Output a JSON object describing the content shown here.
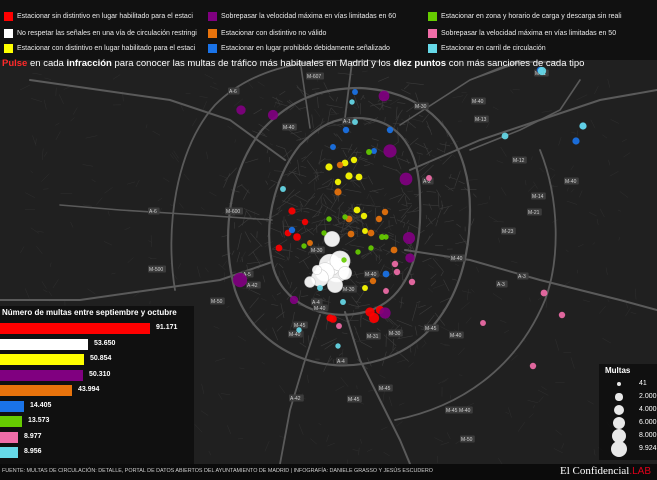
{
  "legend_items": [
    {
      "label": "Estacionar sin distintivo en lugar habilitado para el estaci",
      "color": "#ff0000"
    },
    {
      "label": "Sobrepasar la velocidad máxima en vías limitadas en 60",
      "color": "#800080"
    },
    {
      "label": "Estacionar en zona y horario de carga y descarga sin reali",
      "color": "#66cc00"
    },
    {
      "label": "No respetar las señales en una vía de circulación restringi",
      "color": "#ffffff"
    },
    {
      "label": "Estacionar con distintivo no válido",
      "color": "#e8730c"
    },
    {
      "label": "Sobrepasar la velocidad máxima en vías limitadas en 50",
      "color": "#f06da8"
    },
    {
      "label": "Estacionar con distintivo en lugar habilitado para el estaci",
      "color": "#ffff00"
    },
    {
      "label": "Estacionar en lugar prohibido debidamente señalizado",
      "color": "#1a73e8"
    },
    {
      "label": "Estacionar en carril de circulación",
      "color": "#66d9e8"
    }
  ],
  "headline": {
    "pulse": "Pulse",
    "part1": " en cada ",
    "infraccion": "infracción",
    "part2": " para conocer las multas de tráfico más habituales en Madrid y los ",
    "diez_puntos": "diez puntos",
    "part3": " con más sanciones de cada tipo"
  },
  "bar_chart": {
    "title": "Número de multas entre septiembre y octubre",
    "bars": [
      {
        "value": 91171,
        "label": "91.171",
        "color": "#ff0000"
      },
      {
        "value": 53650,
        "label": "53.650",
        "color": "#ffffff"
      },
      {
        "value": 50854,
        "label": "50.854",
        "color": "#ffff00"
      },
      {
        "value": 50310,
        "label": "50.310",
        "color": "#800080"
      },
      {
        "value": 43994,
        "label": "43.994",
        "color": "#e8730c"
      },
      {
        "value": 14405,
        "label": "14.405",
        "color": "#1a73e8"
      },
      {
        "value": 13573,
        "label": "13.573",
        "color": "#66cc00"
      },
      {
        "value": 8977,
        "label": "8.977",
        "color": "#f06da8"
      },
      {
        "value": 8956,
        "label": "8.956",
        "color": "#66d9e8"
      }
    ]
  },
  "size_legend": {
    "title": "Multas",
    "items": [
      {
        "label": "41",
        "value": 41
      },
      {
        "label": "2.000",
        "value": 2000
      },
      {
        "label": "4.000",
        "value": 4000
      },
      {
        "label": "6.000",
        "value": 6000
      },
      {
        "label": "8.000",
        "value": 8000
      },
      {
        "label": "9.924",
        "value": 9924
      }
    ]
  },
  "road_labels": [
    "M-11",
    "M-40",
    "M-30",
    "M-607",
    "A-6",
    "M-40",
    "A-1",
    "M-13",
    "M-12",
    "A-2",
    "M-40",
    "M-14",
    "M-21",
    "M-23",
    "A-3",
    "M-40",
    "A-4",
    "M-30",
    "M-40",
    "M-45",
    "M-50",
    "A-5",
    "M-30",
    "A-42",
    "M-40",
    "M-45",
    "M-50",
    "M-30",
    "M-45",
    "M-600",
    "A-6",
    "M-500",
    "A-3",
    "M-40",
    "A-4",
    "M-45",
    "M-40",
    "M-31",
    "A-42",
    "M-45",
    "M-40"
  ],
  "points": [
    {
      "cat": "red",
      "value": 900
    },
    {
      "cat": "red",
      "value": 800
    },
    {
      "cat": "red",
      "value": 1000
    },
    {
      "cat": "red",
      "value": 700
    },
    {
      "cat": "red",
      "value": 800
    },
    {
      "cat": "red",
      "value": 1500
    },
    {
      "cat": "red",
      "value": 1200
    },
    {
      "cat": "red",
      "value": 1800
    },
    {
      "cat": "red",
      "value": 900
    },
    {
      "cat": "red",
      "value": 1000
    },
    {
      "cat": "white",
      "value": 4000
    },
    {
      "cat": "white",
      "value": 9924
    },
    {
      "cat": "white",
      "value": 8000
    },
    {
      "cat": "white",
      "value": 7000
    },
    {
      "cat": "white",
      "value": 6000
    },
    {
      "cat": "white",
      "value": 5000
    },
    {
      "cat": "white",
      "value": 4000
    },
    {
      "cat": "white",
      "value": 3000
    },
    {
      "cat": "white",
      "value": 2000
    },
    {
      "cat": "white",
      "value": 1500
    },
    {
      "cat": "yellow",
      "value": 900
    },
    {
      "cat": "yellow",
      "value": 800
    },
    {
      "cat": "yellow",
      "value": 700
    },
    {
      "cat": "yellow",
      "value": 900
    },
    {
      "cat": "yellow",
      "value": 800
    },
    {
      "cat": "yellow",
      "value": 700
    },
    {
      "cat": "yellow",
      "value": 800
    },
    {
      "cat": "yellow",
      "value": 700
    },
    {
      "cat": "yellow",
      "value": 600
    },
    {
      "cat": "yellow",
      "value": 600
    },
    {
      "cat": "purple",
      "value": 3500
    },
    {
      "cat": "purple",
      "value": 2800
    },
    {
      "cat": "purple",
      "value": 2500
    },
    {
      "cat": "purple",
      "value": 2200
    },
    {
      "cat": "purple",
      "value": 2000
    },
    {
      "cat": "purple",
      "value": 1800
    },
    {
      "cat": "purple",
      "value": 1500
    },
    {
      "cat": "purple",
      "value": 1500
    },
    {
      "cat": "purple",
      "value": 1200
    },
    {
      "cat": "purple",
      "value": 3000
    },
    {
      "cat": "orange",
      "value": 900
    },
    {
      "cat": "orange",
      "value": 800
    },
    {
      "cat": "orange",
      "value": 800
    },
    {
      "cat": "orange",
      "value": 700
    },
    {
      "cat": "orange",
      "value": 800
    },
    {
      "cat": "orange",
      "value": 700
    },
    {
      "cat": "orange",
      "value": 800
    },
    {
      "cat": "orange",
      "value": 600
    },
    {
      "cat": "orange",
      "value": 700
    },
    {
      "cat": "orange",
      "value": 700
    },
    {
      "cat": "blue",
      "value": 900
    },
    {
      "cat": "blue",
      "value": 800
    },
    {
      "cat": "blue",
      "value": 700
    },
    {
      "cat": "blue",
      "value": 800
    },
    {
      "cat": "blue",
      "value": 700
    },
    {
      "cat": "blue",
      "value": 600
    },
    {
      "cat": "blue",
      "value": 700
    },
    {
      "cat": "blue",
      "value": 600
    },
    {
      "cat": "blue",
      "value": 600
    },
    {
      "cat": "blue",
      "value": 700
    },
    {
      "cat": "green",
      "value": 600
    },
    {
      "cat": "green",
      "value": 500
    },
    {
      "cat": "green",
      "value": 600
    },
    {
      "cat": "green",
      "value": 500
    },
    {
      "cat": "green",
      "value": 500
    },
    {
      "cat": "green",
      "value": 500
    },
    {
      "cat": "green",
      "value": 500
    },
    {
      "cat": "green",
      "value": 500
    },
    {
      "cat": "green",
      "value": 500
    },
    {
      "cat": "green",
      "value": 500
    },
    {
      "cat": "pink",
      "value": 700
    },
    {
      "cat": "pink",
      "value": 600
    },
    {
      "cat": "pink",
      "value": 800
    },
    {
      "cat": "pink",
      "value": 700
    },
    {
      "cat": "pink",
      "value": 600
    },
    {
      "cat": "pink",
      "value": 700
    },
    {
      "cat": "pink",
      "value": 700
    },
    {
      "cat": "pink",
      "value": 600
    },
    {
      "cat": "pink",
      "value": 700
    },
    {
      "cat": "pink",
      "value": 600
    },
    {
      "cat": "cyan",
      "value": 1200
    },
    {
      "cat": "cyan",
      "value": 900
    },
    {
      "cat": "cyan",
      "value": 800
    },
    {
      "cat": "cyan",
      "value": 600
    },
    {
      "cat": "cyan",
      "value": 500
    },
    {
      "cat": "cyan",
      "value": 600
    },
    {
      "cat": "cyan",
      "value": 500
    },
    {
      "cat": "cyan",
      "value": 600
    },
    {
      "cat": "cyan",
      "value": 500
    },
    {
      "cat": "cyan",
      "value": 600
    }
  ],
  "colors": {
    "red": "#ff0000",
    "white": "#ffffff",
    "yellow": "#ffff00",
    "purple": "#800080",
    "orange": "#e8730c",
    "blue": "#1a73e8",
    "green": "#66cc00",
    "pink": "#f06da8",
    "cyan": "#66d9e8"
  },
  "footer": {
    "credit": "FUENTE: MULTAS DE CIRCULACIÓN: DETALLE, PORTAL DE DATOS ABIERTOS DEL AYUNTAMIENTO DE MADRID | INFOGRAFÍA: DANIELE GRASSO Y JESÚS ESCUDERO",
    "brand": "El Confidencial",
    "brand_suffix": ".LAB"
  }
}
